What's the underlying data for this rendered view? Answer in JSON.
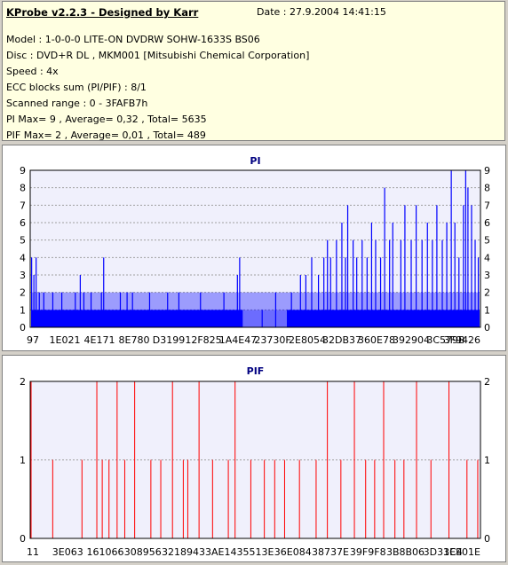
{
  "header": {
    "title": "KProbe v2.2.3 - Designed by Karr",
    "date": "Date : 27.9.2004 14:41:15",
    "lines": [
      "Model : 1-0-0-0 LITE-ON DVDRW SOHW-1633S BS06",
      "Disc : DVD+R DL , MKM001 [Mitsubishi Chemical Corporation]",
      "Speed : 4x",
      "ECC blocks sum (PI/PIF) : 8/1",
      "Scanned range : 0 - 3FAFB7h",
      "PI Max= 9 , Average= 0,32 , Total= 5635",
      "PIF Max= 2 , Average= 0,01 , Total= 489"
    ]
  },
  "colors": {
    "pi": "#0000ff",
    "pif": "#ff0000",
    "title": "#000080"
  },
  "chart_data": [
    {
      "type": "bar",
      "title": "PI",
      "ylim": [
        0,
        9
      ],
      "yticks": [
        "0",
        "1",
        "2",
        "3",
        "4",
        "5",
        "6",
        "7",
        "8",
        "9"
      ],
      "xticks": [
        "97",
        "1E021",
        "4E171",
        "8E780",
        "D3199",
        "12F825",
        "1A4E47",
        "23730F",
        "2E8054",
        "32DB37",
        "360E78",
        "392904",
        "3C579B",
        "3F9426"
      ],
      "grid": true,
      "bars": [
        [
          0.003,
          4
        ],
        [
          0.008,
          3
        ],
        [
          0.013,
          4
        ],
        [
          0.02,
          2
        ],
        [
          0.03,
          2
        ],
        [
          0.05,
          2
        ],
        [
          0.07,
          2
        ],
        [
          0.1,
          2
        ],
        [
          0.111,
          3
        ],
        [
          0.119,
          2
        ],
        [
          0.135,
          2
        ],
        [
          0.158,
          2
        ],
        [
          0.163,
          4
        ],
        [
          0.2,
          2
        ],
        [
          0.215,
          2
        ],
        [
          0.227,
          2
        ],
        [
          0.265,
          2
        ],
        [
          0.305,
          2
        ],
        [
          0.33,
          2
        ],
        [
          0.378,
          2
        ],
        [
          0.43,
          2
        ],
        [
          0.46,
          3
        ],
        [
          0.465,
          4
        ],
        [
          0.515,
          1
        ],
        [
          0.545,
          2
        ],
        [
          0.58,
          2
        ],
        [
          0.6,
          3
        ],
        [
          0.612,
          3
        ],
        [
          0.625,
          4
        ],
        [
          0.64,
          3
        ],
        [
          0.652,
          4
        ],
        [
          0.66,
          5
        ],
        [
          0.667,
          4
        ],
        [
          0.68,
          5
        ],
        [
          0.692,
          6
        ],
        [
          0.7,
          4
        ],
        [
          0.705,
          7
        ],
        [
          0.717,
          5
        ],
        [
          0.725,
          4
        ],
        [
          0.737,
          5
        ],
        [
          0.748,
          4
        ],
        [
          0.758,
          6
        ],
        [
          0.767,
          5
        ],
        [
          0.778,
          4
        ],
        [
          0.787,
          8
        ],
        [
          0.798,
          5
        ],
        [
          0.805,
          6
        ],
        [
          0.823,
          5
        ],
        [
          0.832,
          7
        ],
        [
          0.846,
          5
        ],
        [
          0.857,
          7
        ],
        [
          0.87,
          5
        ],
        [
          0.882,
          6
        ],
        [
          0.893,
          5
        ],
        [
          0.903,
          7
        ],
        [
          0.915,
          5
        ],
        [
          0.925,
          6
        ],
        [
          0.935,
          9
        ],
        [
          0.943,
          6
        ],
        [
          0.952,
          4
        ],
        [
          0.962,
          7
        ],
        [
          0.967,
          9
        ],
        [
          0.972,
          8
        ],
        [
          0.98,
          7
        ],
        [
          0.988,
          5
        ],
        [
          0.995,
          4
        ]
      ]
    },
    {
      "type": "bar",
      "title": "PIF",
      "ylim": [
        0,
        2
      ],
      "yticks": [
        "0",
        "1",
        "2"
      ],
      "xticks": [
        "11",
        "3E063",
        "161066",
        "308956",
        "321894",
        "33AE14",
        "35513E",
        "36E084",
        "38737E",
        "39F9F8",
        "3B8B06",
        "3D31C4",
        "3EE01E"
      ],
      "grid": true,
      "bars": [
        [
          0.002,
          2
        ],
        [
          0.05,
          1
        ],
        [
          0.115,
          1
        ],
        [
          0.148,
          2
        ],
        [
          0.16,
          1
        ],
        [
          0.175,
          1
        ],
        [
          0.193,
          2
        ],
        [
          0.21,
          1
        ],
        [
          0.232,
          2
        ],
        [
          0.268,
          1
        ],
        [
          0.29,
          1
        ],
        [
          0.316,
          2
        ],
        [
          0.34,
          1
        ],
        [
          0.35,
          1
        ],
        [
          0.375,
          2
        ],
        [
          0.405,
          1
        ],
        [
          0.44,
          1
        ],
        [
          0.455,
          2
        ],
        [
          0.49,
          1
        ],
        [
          0.52,
          1
        ],
        [
          0.543,
          1
        ],
        [
          0.565,
          1
        ],
        [
          0.598,
          1
        ],
        [
          0.635,
          1
        ],
        [
          0.66,
          2
        ],
        [
          0.69,
          1
        ],
        [
          0.72,
          2
        ],
        [
          0.745,
          1
        ],
        [
          0.765,
          1
        ],
        [
          0.785,
          2
        ],
        [
          0.81,
          1
        ],
        [
          0.83,
          1
        ],
        [
          0.858,
          2
        ],
        [
          0.89,
          1
        ],
        [
          0.93,
          2
        ],
        [
          0.97,
          1
        ],
        [
          0.994,
          1
        ]
      ]
    }
  ]
}
